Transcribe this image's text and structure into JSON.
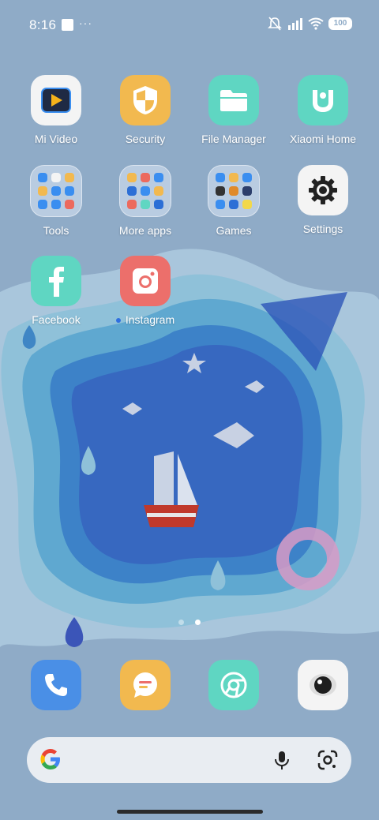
{
  "status_bar": {
    "time": "8:16",
    "dots": "···",
    "battery": "100"
  },
  "apps": [
    {
      "label": "Mi Video",
      "icon": "mi-video-icon"
    },
    {
      "label": "Security",
      "icon": "security-shield-icon"
    },
    {
      "label": "File Manager",
      "icon": "folder-icon"
    },
    {
      "label": "Xiaomi Home",
      "icon": "xiaomi-home-icon"
    },
    {
      "label": "Tools",
      "icon": "tools-folder-icon"
    },
    {
      "label": "More apps",
      "icon": "more-apps-folder-icon"
    },
    {
      "label": "Games",
      "icon": "games-folder-icon"
    },
    {
      "label": "Settings",
      "icon": "settings-gear-icon"
    },
    {
      "label": "Facebook",
      "icon": "facebook-icon"
    },
    {
      "label": "Instagram",
      "icon": "instagram-icon"
    }
  ],
  "pager": {
    "pages": 2,
    "current": 2
  },
  "dock": [
    {
      "icon": "phone-icon"
    },
    {
      "icon": "messages-icon"
    },
    {
      "icon": "chrome-icon"
    },
    {
      "icon": "camera-icon"
    }
  ],
  "colors": {
    "background": "#8fabc7",
    "search_bar": "#e9edf2"
  }
}
